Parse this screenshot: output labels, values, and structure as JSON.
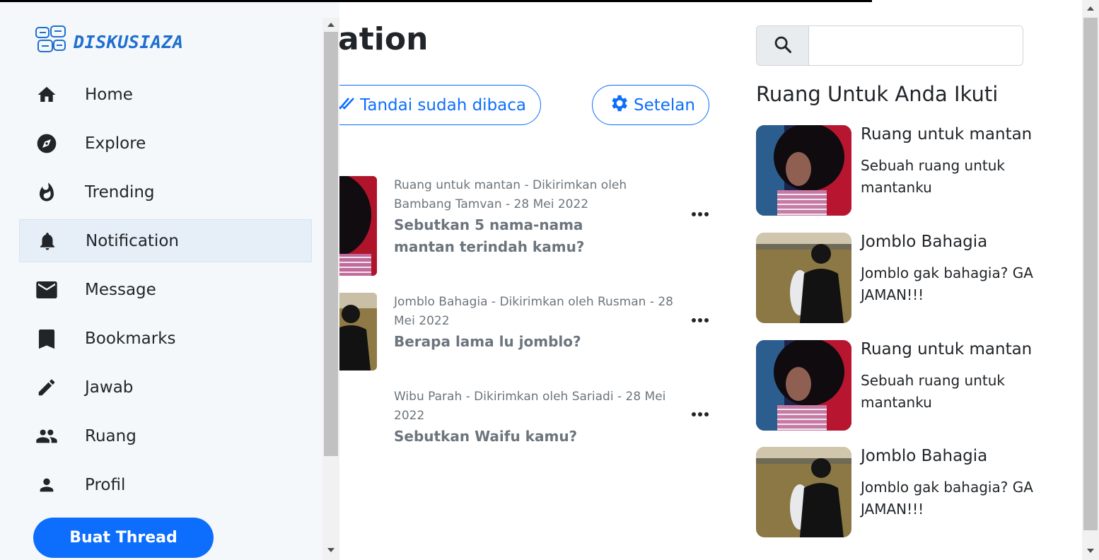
{
  "app": {
    "name": "DISKUSIAZA"
  },
  "sidebar": {
    "items": [
      {
        "label": "Home",
        "icon": "home-icon",
        "active": false
      },
      {
        "label": "Explore",
        "icon": "compass-icon",
        "active": false
      },
      {
        "label": "Trending",
        "icon": "flame-icon",
        "active": false
      },
      {
        "label": "Notification",
        "icon": "bell-icon",
        "active": true
      },
      {
        "label": "Message",
        "icon": "mail-icon",
        "active": false
      },
      {
        "label": "Bookmarks",
        "icon": "bookmark-icon",
        "active": false
      },
      {
        "label": "Jawab",
        "icon": "pencil-icon",
        "active": false
      },
      {
        "label": "Ruang",
        "icon": "people-icon",
        "active": false
      },
      {
        "label": "Profil",
        "icon": "person-icon",
        "active": false
      }
    ],
    "create_button": "Buat Thread"
  },
  "main": {
    "title": "otification",
    "mark_read_label": "Tandai sudah dibaca",
    "settings_label": "Setelan",
    "notifications": [
      {
        "meta": "Ruang untuk mantan - Dikirimkan oleh Bambang Tamvan - 28 Mei 2022",
        "title": "Sebutkan 5 nama-nama mantan terindah kamu?",
        "thumb": "red-portrait"
      },
      {
        "meta": "Jomblo Bahagia - Dikirimkan oleh Rusman - 28 Mei 2022",
        "title": "Berapa lama lu jomblo?",
        "thumb": "field-suit"
      },
      {
        "meta": "Wibu Parah - Dikirimkan oleh Sariadi - 28 Mei 2022",
        "title": "Sebutkan Waifu kamu?",
        "thumb": "none"
      }
    ]
  },
  "right": {
    "search": {
      "placeholder": "",
      "value": ""
    },
    "heading": "Ruang Untuk Anda Ikuti",
    "rooms": [
      {
        "name": "Ruang untuk mantan",
        "desc": "Sebuah ruang untuk mantanku",
        "thumb": "red-portrait"
      },
      {
        "name": "Jomblo Bahagia",
        "desc": "Jomblo gak bahagia? GA JAMAN!!!",
        "thumb": "field-suit"
      },
      {
        "name": "Ruang untuk mantan",
        "desc": "Sebuah ruang untuk mantanku",
        "thumb": "red-portrait"
      },
      {
        "name": "Jomblo Bahagia",
        "desc": "Jomblo gak bahagia? GA JAMAN!!!",
        "thumb": "field-suit"
      }
    ]
  },
  "colors": {
    "primary": "#0d6efd",
    "sidebar_bg": "#f5f8fb",
    "active_bg": "#e6eef7",
    "muted": "#6c757d",
    "logo": "#1f6fd0"
  }
}
